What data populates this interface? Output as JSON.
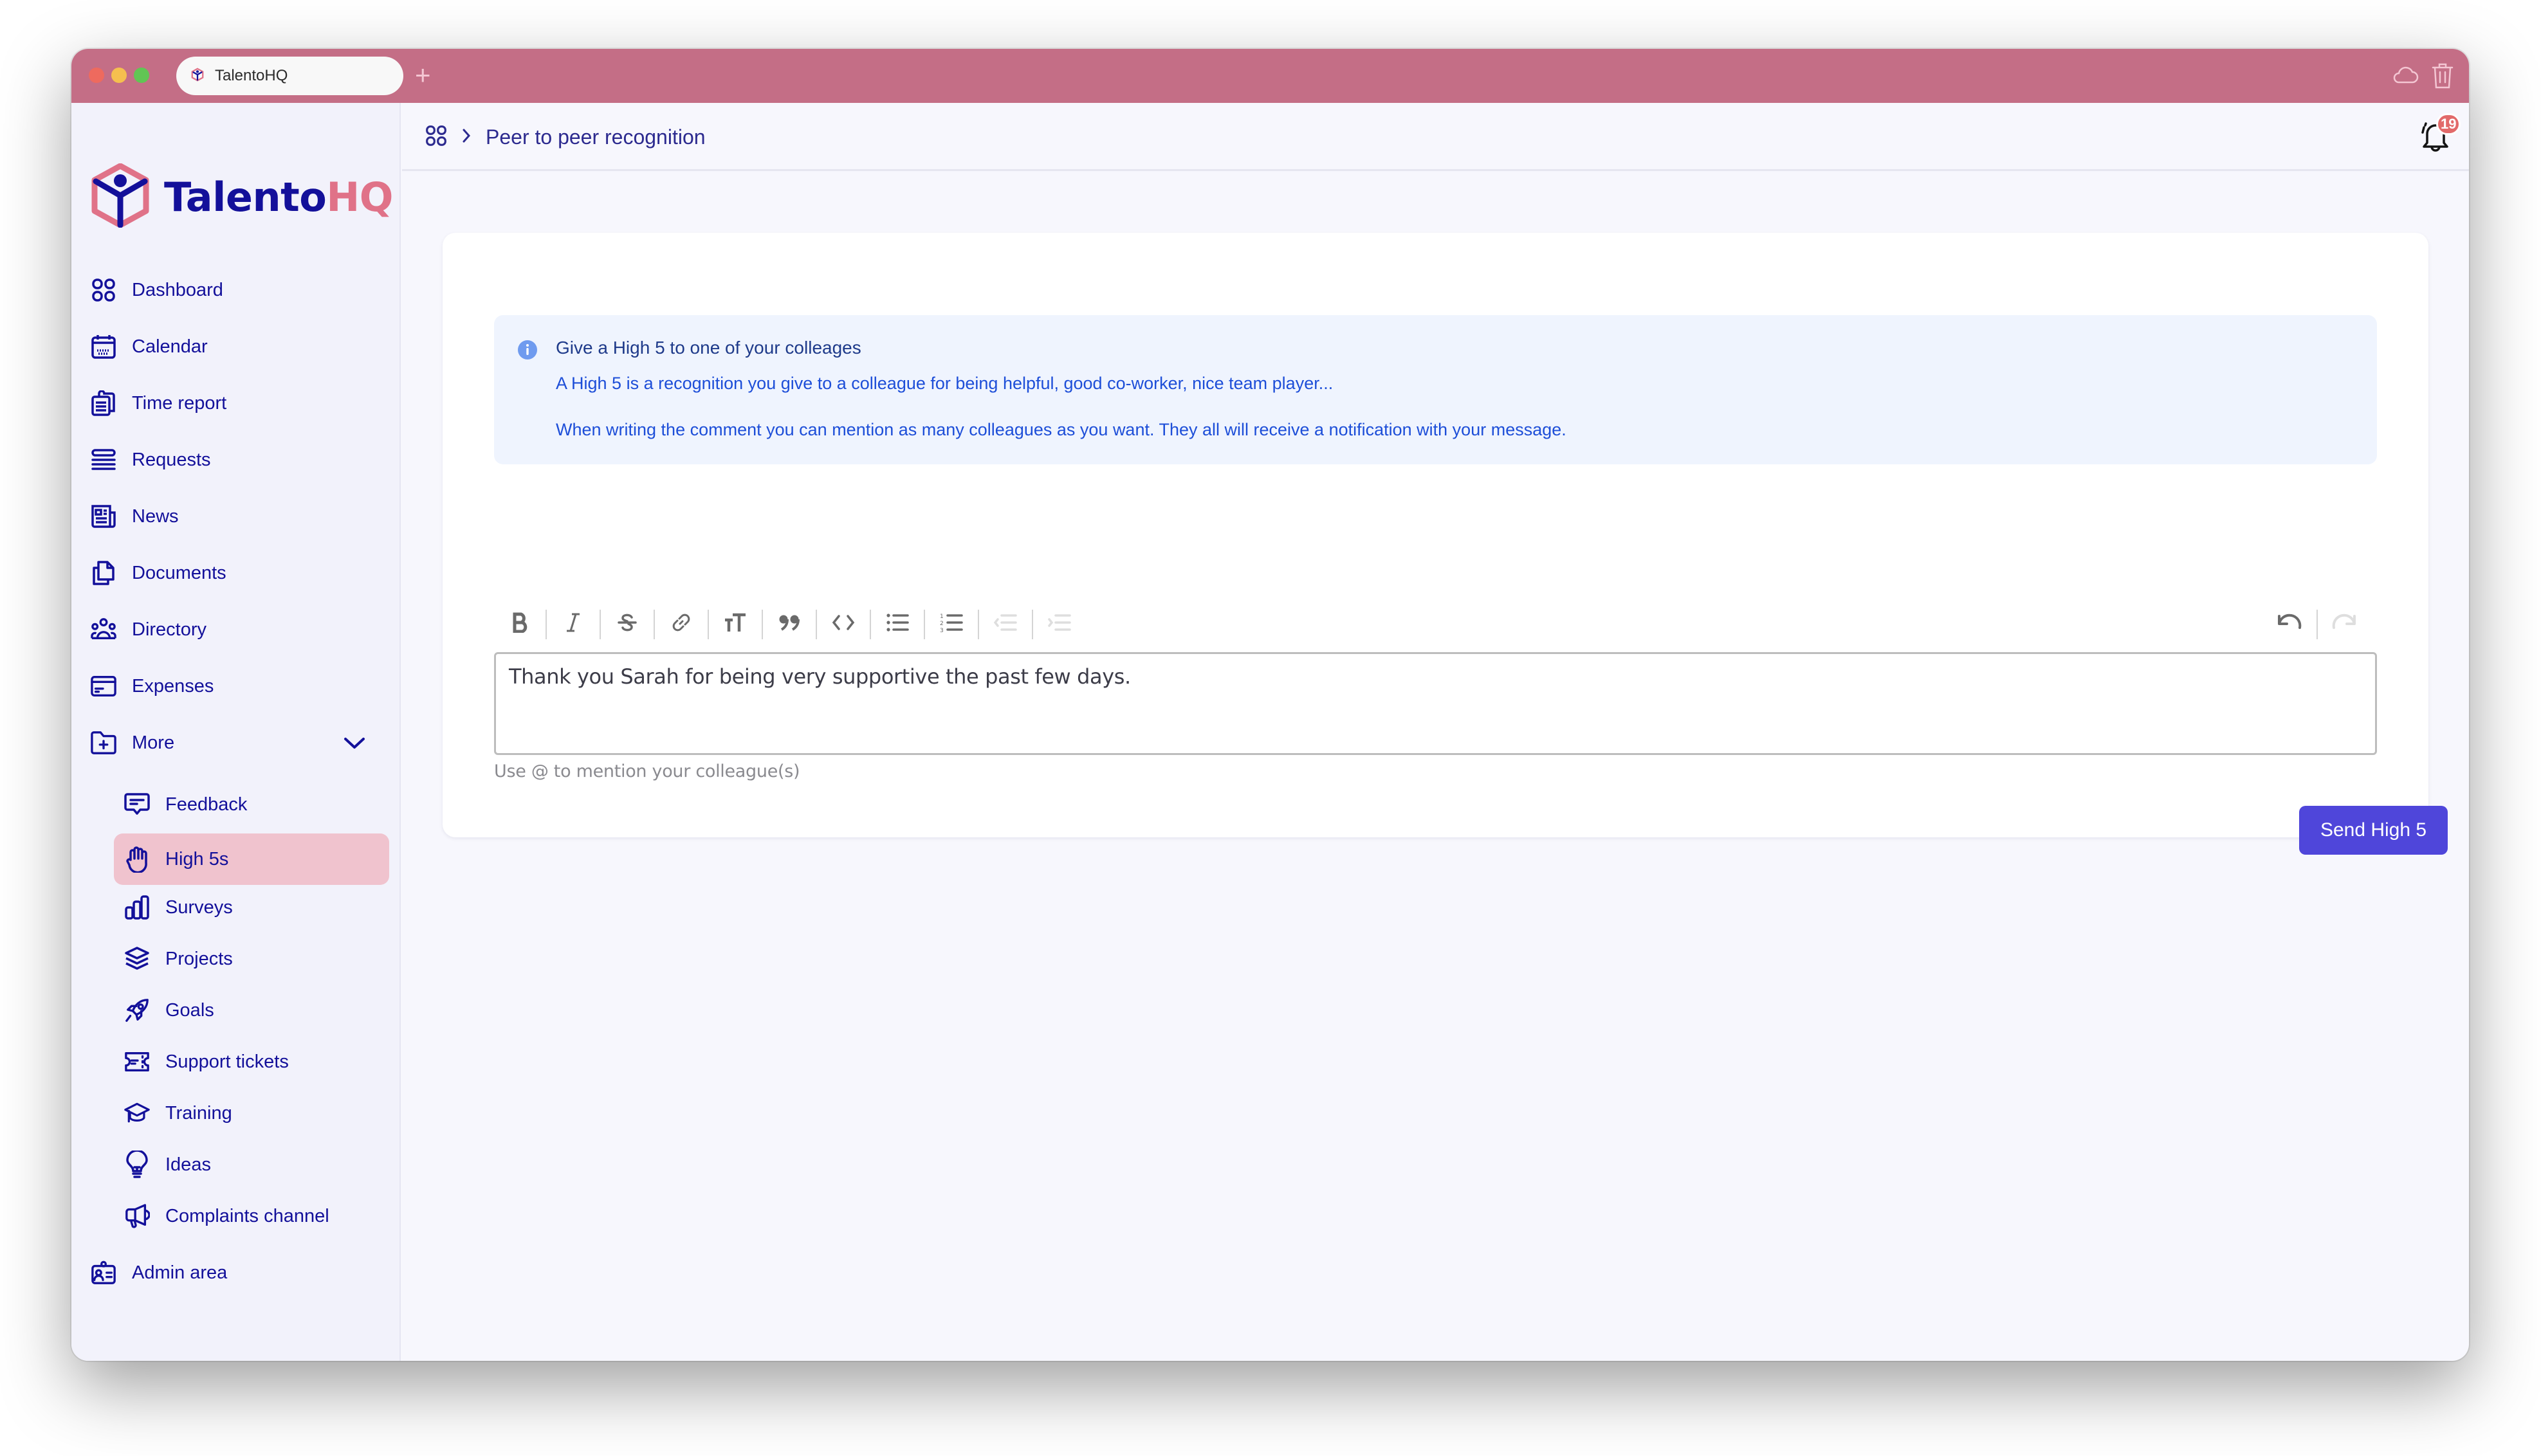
{
  "browser": {
    "tab_title": "TalentoHQ",
    "new_tab_label": "+",
    "icons": [
      "cloud-icon",
      "trash-icon"
    ]
  },
  "brand": {
    "name_part1": "Talento",
    "name_part2": "HQ",
    "primary_color": "#13109A",
    "accent_color": "#E07288",
    "titlebar_color": "#C46E86"
  },
  "sidebar": {
    "items": [
      {
        "label": "Dashboard",
        "icon": "grid-icon"
      },
      {
        "label": "Calendar",
        "icon": "calendar-icon"
      },
      {
        "label": "Time report",
        "icon": "clipboard-icon"
      },
      {
        "label": "Requests",
        "icon": "list-icon"
      },
      {
        "label": "News",
        "icon": "newspaper-icon"
      },
      {
        "label": "Documents",
        "icon": "documents-icon"
      },
      {
        "label": "Directory",
        "icon": "people-icon"
      },
      {
        "label": "Expenses",
        "icon": "credit-card-icon"
      },
      {
        "label": "More",
        "icon": "folder-plus-icon",
        "expanded": true
      }
    ],
    "more_items": [
      {
        "label": "Feedback",
        "icon": "chat-icon"
      },
      {
        "label": "High 5s",
        "icon": "hand-icon",
        "active": true
      },
      {
        "label": "Surveys",
        "icon": "bar-chart-icon"
      },
      {
        "label": "Projects",
        "icon": "layers-icon"
      },
      {
        "label": "Goals",
        "icon": "rocket-icon"
      },
      {
        "label": "Support tickets",
        "icon": "ticket-icon"
      },
      {
        "label": "Training",
        "icon": "graduation-cap-icon"
      },
      {
        "label": "Ideas",
        "icon": "lightbulb-icon"
      },
      {
        "label": "Complaints channel",
        "icon": "megaphone-icon"
      }
    ],
    "admin": {
      "label": "Admin area",
      "icon": "id-badge-icon"
    }
  },
  "header": {
    "breadcrumb_current": "Peer to peer recognition",
    "notification_count": "19"
  },
  "info": {
    "title": "Give a High 5 to one of your colleages",
    "line1": "A High 5 is a recognition you give to a colleague for being helpful, good co-worker, nice team player...",
    "line2": "When writing the comment you can mention as many colleagues as you want. They all will receive a notification with your message."
  },
  "editor": {
    "toolbar": [
      "bold",
      "italic",
      "strikethrough",
      "link",
      "heading",
      "quote",
      "code",
      "bullet-list",
      "ordered-list",
      "outdent",
      "indent",
      "undo",
      "redo"
    ],
    "content": "Thank you Sarah for being very supportive the past few days.",
    "hint": "Use @ to mention your colleague(s)"
  },
  "actions": {
    "send_label": "Send High 5",
    "send_color": "#4F46DA"
  }
}
